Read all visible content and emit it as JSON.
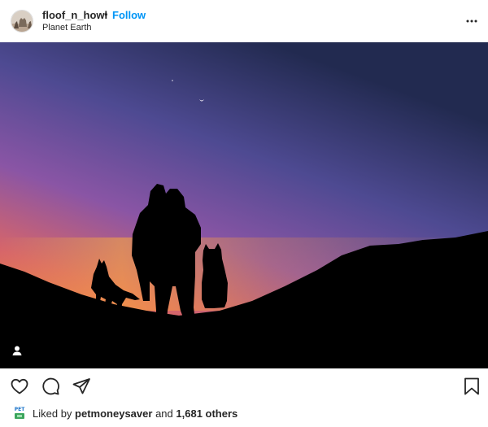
{
  "post": {
    "username": "floof_n_howl",
    "separator": "•",
    "follow_label": "Follow",
    "location": "Planet Earth"
  },
  "likes": {
    "prefix": "Liked by",
    "liker": "petmoneysaver",
    "and": "and",
    "count_text": "1,681 others",
    "liker_avatar_text": "PET"
  },
  "icons": {
    "more": "more-options-icon",
    "like": "heart-icon",
    "comment": "comment-icon",
    "share": "paper-plane-icon",
    "save": "bookmark-icon",
    "user_tag": "person-icon"
  },
  "colors": {
    "accent": "#0095f6",
    "text": "#262626"
  }
}
